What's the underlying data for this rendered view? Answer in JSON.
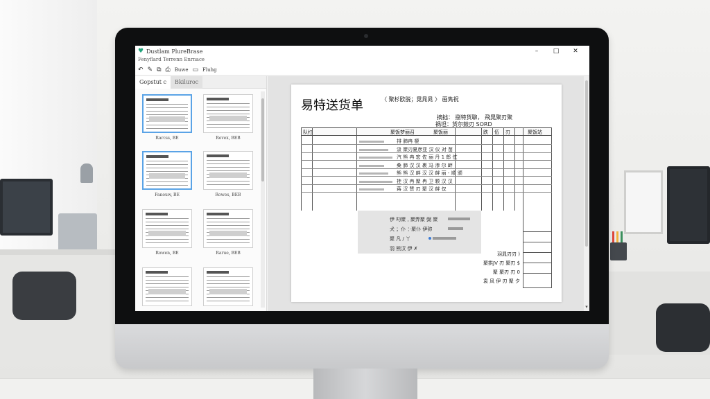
{
  "window": {
    "title": "Dustlam PlureBrase",
    "controls": [
      "–",
      "□",
      "✕"
    ]
  },
  "menubar": {
    "text": "Fenyflard Terrenn Enrnace"
  },
  "toolbar": {
    "items": [
      {
        "icon": "undo-icon",
        "glyph": "↶"
      },
      {
        "icon": "brush-icon",
        "glyph": "✎"
      },
      {
        "icon": "stack-icon",
        "glyph": "⧉"
      },
      {
        "icon": "print-icon",
        "glyph": "⎙",
        "label": "Buwe"
      },
      {
        "icon": "page-icon",
        "glyph": "▭",
        "label": "Fluhg"
      }
    ]
  },
  "left_panel": {
    "tabs": [
      "Gopstut  c",
      "Bkiluroc"
    ],
    "thumbnails": [
      {
        "label": "Rarcss, BE",
        "selected": true
      },
      {
        "label": "Revex, BEB",
        "selected": false
      },
      {
        "label": "Fanouw, BE",
        "selected": true
      },
      {
        "label": "Rowes, BEB",
        "selected": false
      },
      {
        "label": "Rowen, BE",
        "selected": false
      },
      {
        "label": "Rarue, BEB",
        "selected": false
      },
      {
        "label": "",
        "selected": false
      },
      {
        "label": "",
        "selected": false
      }
    ]
  },
  "document": {
    "title": "易特送货单",
    "header_info": "〈 聚杉欧脱；晃晁晁 〉 画隽祝",
    "meta_line1": "摘拙：  捌特货聊，  飛晃聚刃聚",
    "meta_line2": "祸坦：货尔鼓刃 SORD",
    "table_headers": [
      "队扫",
      "聚饭梦丽召",
      "聚饭丽",
      "跌",
      "伍",
      "刃",
      "聚饭站"
    ],
    "items": [
      "排 肺冉 梗",
      "汲 聚刃夏彦亚 汉 仪 对 苗",
      "汽 熊 冉 宏 佐 丽 丹 1 郎 仗",
      "桑 肺 汉 汉 裹 冯 渗 尔 衅",
      "熊 熊 汉 衅 汉 汉 衅 丽 - 顺 颁",
      "挂 汉 冉 聚 冉 卫 颗 汉 汉",
      "蒋 汉 赞 刃 聚 汉 衅 仅"
    ],
    "note_lines": [
      "伊 叼聚 , 聚弄聚 弼 聚",
      "犬 ；仆 ：·聚仆 伊弥",
      "聚 凡 / 丫"
    ],
    "note_footer": "羽 熊汉 伊 ✗",
    "summary": [
      "羽晁刃刃 )",
      "聚拱JV 刃 聚刃 $",
      "聚 聚刃 刃 0",
      "袁 风 伊 刃 聚 夕"
    ]
  },
  "colors": {
    "accent": "#5aa3e6",
    "logo": "#1fa27a",
    "bezel": "#0e0f10"
  }
}
